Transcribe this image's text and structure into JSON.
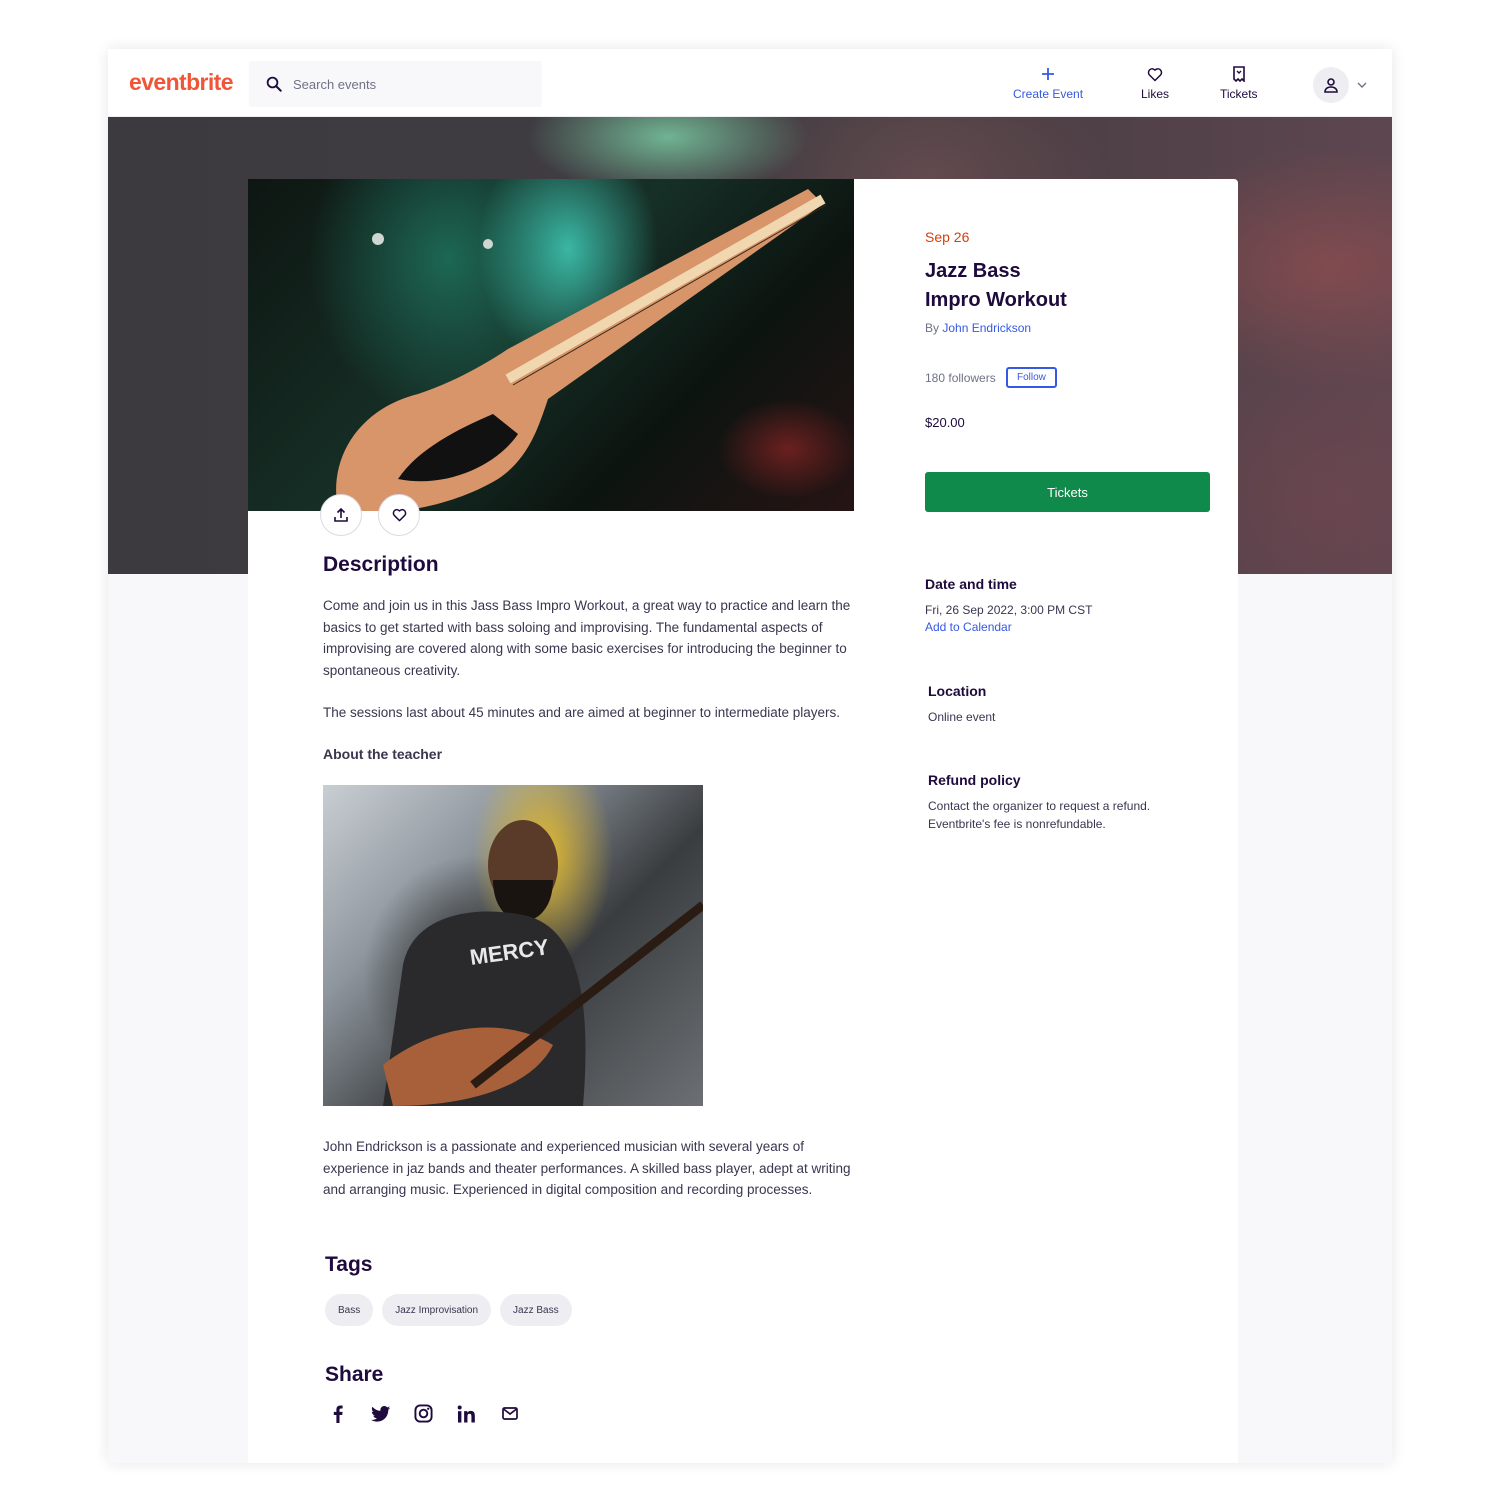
{
  "header": {
    "logo": "eventbrite",
    "search_placeholder": "Search events",
    "nav": {
      "create_event": "Create Event",
      "likes": "Likes",
      "tickets": "Tickets"
    }
  },
  "event": {
    "date_short": "Sep 26",
    "title_line1": "Jazz Bass",
    "title_line2": "Impro Workout",
    "by_prefix": "By",
    "organizer": "John Endrickson",
    "followers": "180 followers",
    "follow_label": "Follow",
    "price": "$20.00",
    "tickets_label": "Tickets"
  },
  "details": {
    "date_heading": "Date and time",
    "date_value": "Fri, 26 Sep 2022, 3:00 PM CST",
    "add_calendar": "Add to Calendar",
    "location_heading": "Location",
    "location_value": "Online event",
    "refund_heading": "Refund policy",
    "refund_line1": "Contact the organizer to request a refund.",
    "refund_line2": "Eventbrite's fee is nonrefundable."
  },
  "description": {
    "heading": "Description",
    "paragraph1": "Come and join us in this Jass Bass Impro Workout, a great way to practice and learn the basics to get started with bass soloing and improvising. The fundamental aspects of improvising are covered along with some basic exercises for introducing the beginner to spontaneous creativity.",
    "paragraph2": "The sessions last about 45 minutes and are aimed at beginner to intermediate players.",
    "about_heading": "About the teacher",
    "teacher_bio": "John Endrickson is a passionate and experienced musician with several years of experience in jaz bands and theater performances. A skilled bass player, adept at writing and arranging music. Experienced in digital composition and recording processes."
  },
  "tags": {
    "heading": "Tags",
    "items": [
      "Bass",
      "Jazz Improvisation",
      "Jazz Bass"
    ]
  },
  "share": {
    "heading": "Share",
    "icons": [
      "facebook-icon",
      "twitter-icon",
      "instagram-icon",
      "linkedin-icon",
      "email-icon"
    ]
  },
  "colors": {
    "brand": "#f05537",
    "date_accent": "#d1410c",
    "link": "#3659e3",
    "primary_button": "#0f8a4a",
    "text": "#1e0a3c"
  }
}
